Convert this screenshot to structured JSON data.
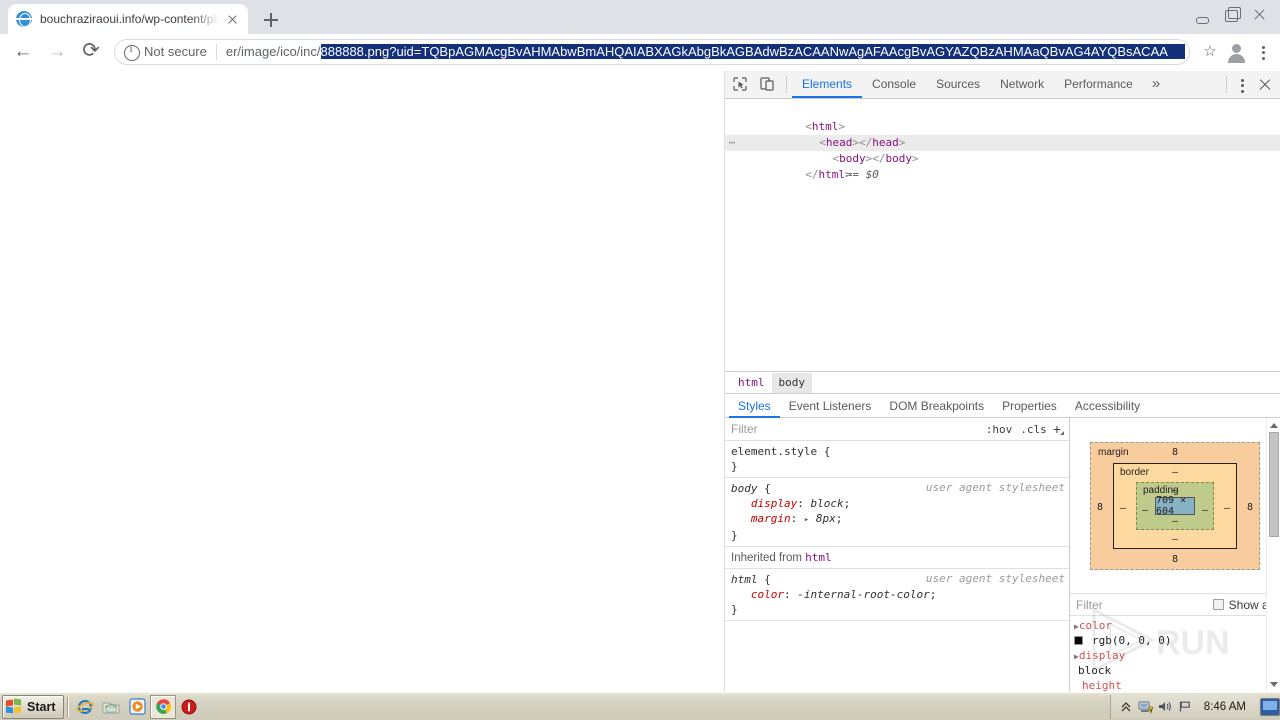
{
  "browser": {
    "tab": {
      "title": "bouchraziraoui.info/wp-content/plug",
      "favicon_name": "globe-favicon",
      "close_label": "Close tab"
    },
    "new_tab_label": "New Tab",
    "window_controls": {
      "minimize": "Minimize",
      "maximize": "Restore",
      "close": "Close"
    },
    "nav": {
      "back": "Back",
      "forward": "Forward",
      "reload": "Reload"
    },
    "omnibox": {
      "security_label": "Not secure",
      "url_prefix": "er/image/ico/inc/",
      "url_selected": "888888.png?uid=TQBpAGMAcgBvAHMAbwBmAHQAIABXAGkAbgBkAGBAdwBzACAANwAgAFAAcgBvAGYAZQBzAHMAaQBvAG4AYQBsACAA",
      "bookmark_label": "Bookmark this page",
      "profile_label": "Profile",
      "menu_label": "Customize and control Google Chrome"
    }
  },
  "devtools": {
    "toolbar": {
      "inspect_label": "Inspect element",
      "device_label": "Toggle device toolbar",
      "more_label": "More tabs",
      "kebab_label": "Customize and control DevTools",
      "close_label": "Close DevTools",
      "tabs": [
        {
          "label": "Elements",
          "active": true
        },
        {
          "label": "Console",
          "active": false
        },
        {
          "label": "Sources",
          "active": false
        },
        {
          "label": "Network",
          "active": false
        },
        {
          "label": "Performance",
          "active": false
        }
      ],
      "overflow_glyph": "»"
    },
    "dom": {
      "lines": [
        {
          "text": "<html>",
          "selected": false,
          "indent": 0
        },
        {
          "text": "<head></head>",
          "selected": false,
          "indent": 1
        },
        {
          "text": "<body></body>",
          "selected": true,
          "indent": 1,
          "suffix": "== $0"
        },
        {
          "text": "</html>",
          "selected": false,
          "indent": 0
        }
      ]
    },
    "breadcrumbs": [
      {
        "label": "html",
        "selected": false
      },
      {
        "label": "body",
        "selected": true
      }
    ],
    "sidebar_tabs": [
      {
        "label": "Styles",
        "active": true
      },
      {
        "label": "Event Listeners",
        "active": false
      },
      {
        "label": "DOM Breakpoints",
        "active": false
      },
      {
        "label": "Properties",
        "active": false
      },
      {
        "label": "Accessibility",
        "active": false
      }
    ],
    "styles": {
      "filter_placeholder": "Filter",
      "hov_label": ":hov",
      "cls_label": ".cls",
      "new_rule_label": "+",
      "rules": [
        {
          "selector": "element.style",
          "origin": "",
          "declarations": []
        },
        {
          "selector": "body",
          "origin": "user agent stylesheet",
          "declarations": [
            {
              "property": "display",
              "value": "block"
            },
            {
              "property": "margin",
              "value": "8px",
              "expandable": true
            }
          ]
        }
      ],
      "inherited_from_label": "Inherited from",
      "inherited_from_tag": "html",
      "inherited_rules": [
        {
          "selector": "html",
          "origin": "user agent stylesheet",
          "declarations": [
            {
              "property": "color",
              "value": "-internal-root-color"
            }
          ]
        }
      ]
    },
    "box_model": {
      "margin_label": "margin",
      "border_label": "border",
      "padding_label": "padding",
      "content_size": "709 × 604",
      "margin_top": "8",
      "margin_right": "8",
      "margin_bottom": "8",
      "margin_left": "8",
      "border_top": "–",
      "border_right": "–",
      "border_bottom": "–",
      "border_left": "–",
      "padding_top": "–",
      "padding_right": "–",
      "padding_bottom": "–",
      "padding_left": "–"
    },
    "computed": {
      "filter_placeholder": "Filter",
      "show_all_label": "Show all",
      "properties": [
        {
          "name": "color",
          "value": "rgb(0, 0, 0)",
          "swatch": "#000000"
        },
        {
          "name": "display",
          "value": "block"
        },
        {
          "name": "height",
          "value": ""
        }
      ]
    }
  },
  "watermark": {
    "text": "ANY.RUN"
  },
  "taskbar": {
    "start_label": "Start",
    "quick_launch": [
      {
        "name": "internet-explorer-icon",
        "title": "Internet Explorer"
      },
      {
        "name": "explorer-folder-icon",
        "title": "Windows Explorer"
      },
      {
        "name": "media-player-icon",
        "title": "Windows Media Player"
      },
      {
        "name": "chrome-icon",
        "title": "Google Chrome",
        "pressed": true
      },
      {
        "name": "shield-stop-icon",
        "title": "Security"
      }
    ],
    "tray": [
      {
        "name": "show-hidden-icons",
        "glyph": "«"
      },
      {
        "name": "network-warning-icon"
      },
      {
        "name": "volume-icon"
      },
      {
        "name": "flag-icon"
      }
    ],
    "clock": "8:46 AM",
    "show_desktop_label": "Show desktop"
  }
}
